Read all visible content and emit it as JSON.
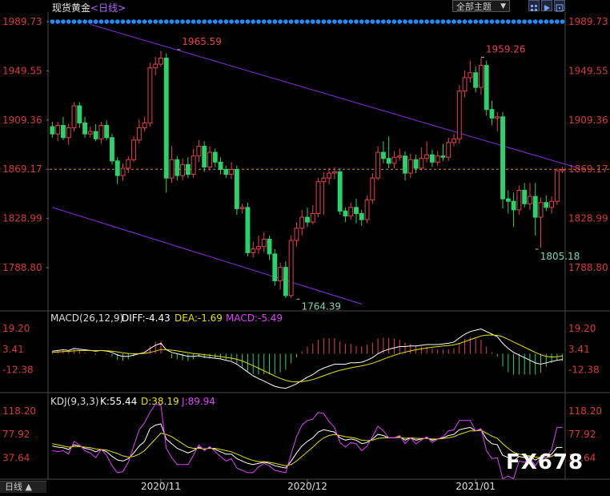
{
  "header": {
    "title": "现货黄金",
    "period": "<日线>",
    "theme_selector": "全部主题",
    "theme_arrow": "▼"
  },
  "colors": {
    "up": "#e8404a",
    "down": "#2bd26b",
    "channel": "#8a2be2",
    "dashed": "#d8901a",
    "axis_text_price": "#d73a3a",
    "diff": "#ffffff",
    "dea": "#e8e000",
    "macd_label": "#e040fb",
    "k": "#ffffff",
    "d": "#e8e000",
    "j": "#e040fb",
    "dots": "#1f8fff"
  },
  "chart_data": {
    "type": "candlestick",
    "price_axis": {
      "ticks": [
        "1989.73",
        "1949.55",
        "1909.36",
        "1869.17",
        "1828.99",
        "1788.80"
      ],
      "ylim": [
        1760.0,
        1995.0
      ]
    },
    "current_price_line": 1869.17,
    "annotations": [
      {
        "label": "1965.59",
        "value": 1965.59,
        "index": 23,
        "color": "#e8404a",
        "side": "right",
        "dir": "up"
      },
      {
        "label": "1959.26",
        "value": 1959.26,
        "index": 79,
        "color": "#e8404a",
        "side": "right",
        "dir": "up"
      },
      {
        "label": "1764.39",
        "value": 1764.39,
        "index": 45,
        "color": "#7ad7b0",
        "side": "right",
        "dir": "down"
      },
      {
        "label": "1805.18",
        "value": 1805.18,
        "index": 89,
        "color": "#7ad7b0",
        "side": "right",
        "dir": "down"
      }
    ],
    "x_labels": [
      {
        "label": "2020/11",
        "index": 20
      },
      {
        "label": "2020/12",
        "index": 47
      },
      {
        "label": "2021/01",
        "index": 78
      }
    ],
    "channel_upper": [
      {
        "index": 7,
        "value": 1987.5
      },
      {
        "index": 97,
        "value": 1870.0
      }
    ],
    "channel_lower": [
      {
        "index": 0,
        "value": 1838.0
      },
      {
        "index": 57,
        "value": 1759.0
      }
    ],
    "candles": [
      [
        1904,
        1898,
        1908,
        1895
      ],
      [
        1898,
        1905,
        1908,
        1892
      ],
      [
        1905,
        1895,
        1912,
        1893
      ],
      [
        1895,
        1903,
        1906,
        1889
      ],
      [
        1903,
        1921,
        1924,
        1900
      ],
      [
        1921,
        1907,
        1924,
        1903
      ],
      [
        1907,
        1898,
        1912,
        1895
      ],
      [
        1898,
        1900,
        1904,
        1895
      ],
      [
        1900,
        1894,
        1906,
        1892
      ],
      [
        1894,
        1905,
        1908,
        1890
      ],
      [
        1905,
        1895,
        1909,
        1893
      ],
      [
        1895,
        1876,
        1898,
        1873
      ],
      [
        1876,
        1864,
        1879,
        1857
      ],
      [
        1864,
        1870,
        1874,
        1860
      ],
      [
        1870,
        1877,
        1880,
        1866
      ],
      [
        1877,
        1893,
        1896,
        1875
      ],
      [
        1893,
        1903,
        1910,
        1890
      ],
      [
        1903,
        1907,
        1912,
        1900
      ],
      [
        1907,
        1952,
        1956,
        1904
      ],
      [
        1952,
        1955,
        1961,
        1946
      ],
      [
        1955,
        1960,
        1966,
        1953
      ],
      [
        1960,
        1862,
        1964,
        1850
      ],
      [
        1862,
        1877,
        1888,
        1858
      ],
      [
        1877,
        1864,
        1880,
        1860
      ],
      [
        1864,
        1873,
        1878,
        1860
      ],
      [
        1873,
        1865,
        1879,
        1862
      ],
      [
        1865,
        1880,
        1886,
        1862
      ],
      [
        1880,
        1888,
        1893,
        1875
      ],
      [
        1888,
        1871,
        1892,
        1867
      ],
      [
        1871,
        1883,
        1888,
        1868
      ],
      [
        1883,
        1875,
        1886,
        1871
      ],
      [
        1875,
        1869,
        1879,
        1865
      ],
      [
        1869,
        1865,
        1872,
        1862
      ],
      [
        1865,
        1869,
        1875,
        1861
      ],
      [
        1869,
        1837,
        1872,
        1832
      ],
      [
        1837,
        1838,
        1841,
        1833
      ],
      [
        1838,
        1801,
        1842,
        1798
      ],
      [
        1801,
        1804,
        1810,
        1797
      ],
      [
        1804,
        1806,
        1815,
        1800
      ],
      [
        1806,
        1812,
        1818,
        1801
      ],
      [
        1812,
        1800,
        1815,
        1795
      ],
      [
        1800,
        1778,
        1804,
        1774
      ],
      [
        1778,
        1789,
        1793,
        1771
      ],
      [
        1789,
        1766,
        1794,
        1764
      ],
      [
        1766,
        1811,
        1815,
        1764
      ],
      [
        1811,
        1821,
        1826,
        1806
      ],
      [
        1821,
        1830,
        1836,
        1815
      ],
      [
        1830,
        1826,
        1838,
        1822
      ],
      [
        1826,
        1833,
        1840,
        1824
      ],
      [
        1833,
        1859,
        1862,
        1830
      ],
      [
        1859,
        1862,
        1867,
        1832
      ],
      [
        1862,
        1866,
        1870,
        1857
      ],
      [
        1866,
        1867,
        1871,
        1861
      ],
      [
        1867,
        1835,
        1870,
        1832
      ],
      [
        1835,
        1831,
        1838,
        1826
      ],
      [
        1831,
        1838,
        1842,
        1828
      ],
      [
        1838,
        1833,
        1845,
        1825
      ],
      [
        1833,
        1828,
        1836,
        1823
      ],
      [
        1828,
        1844,
        1848,
        1825
      ],
      [
        1844,
        1862,
        1866,
        1841
      ],
      [
        1862,
        1883,
        1888,
        1860
      ],
      [
        1883,
        1878,
        1892,
        1874
      ],
      [
        1878,
        1874,
        1896,
        1870
      ],
      [
        1874,
        1879,
        1884,
        1870
      ],
      [
        1879,
        1880,
        1886,
        1876
      ],
      [
        1880,
        1866,
        1884,
        1860
      ],
      [
        1866,
        1877,
        1882,
        1862
      ],
      [
        1877,
        1870,
        1881,
        1866
      ],
      [
        1870,
        1878,
        1887,
        1868
      ],
      [
        1878,
        1881,
        1892,
        1875
      ],
      [
        1881,
        1875,
        1885,
        1871
      ],
      [
        1875,
        1880,
        1884,
        1872
      ],
      [
        1880,
        1879,
        1890,
        1876
      ],
      [
        1879,
        1891,
        1895,
        1876
      ],
      [
        1891,
        1894,
        1898,
        1888
      ],
      [
        1894,
        1933,
        1938,
        1890
      ],
      [
        1933,
        1944,
        1950,
        1928
      ],
      [
        1944,
        1948,
        1958,
        1940
      ],
      [
        1948,
        1936,
        1953,
        1932
      ],
      [
        1936,
        1954,
        1960,
        1930
      ],
      [
        1954,
        1918,
        1958,
        1913
      ],
      [
        1918,
        1911,
        1925,
        1905
      ],
      [
        1911,
        1912,
        1916,
        1900
      ],
      [
        1912,
        1845,
        1916,
        1837
      ],
      [
        1845,
        1843,
        1852,
        1833
      ],
      [
        1843,
        1836,
        1850,
        1822
      ],
      [
        1836,
        1852,
        1856,
        1832
      ],
      [
        1852,
        1841,
        1858,
        1838
      ],
      [
        1841,
        1847,
        1858,
        1836
      ],
      [
        1847,
        1830,
        1858,
        1815
      ],
      [
        1830,
        1842,
        1846,
        1805
      ],
      [
        1842,
        1838,
        1848,
        1835
      ],
      [
        1838,
        1843,
        1847,
        1833
      ],
      [
        1843,
        1868,
        1870,
        1840
      ],
      [
        1868,
        1869,
        1871,
        1866
      ]
    ],
    "macd": {
      "label": "MACD(26,12,9)",
      "diff_label": "DIFF:-4.43",
      "dea_label": "DEA:-1.69",
      "macd_label": "MACD:-5.49",
      "ticks": [
        "19.20",
        "3.41",
        "-12.38"
      ],
      "ylim": [
        -28.0,
        23.0
      ],
      "diff": [
        2,
        2.5,
        3,
        2.5,
        4,
        3.5,
        3,
        2.5,
        2,
        2.5,
        2,
        1,
        -1,
        -2,
        -2,
        -1,
        0,
        1,
        4,
        6.5,
        8,
        3,
        1,
        0,
        -1,
        -2,
        -2,
        -1.5,
        -2.5,
        -3,
        -3.5,
        -4,
        -5,
        -6,
        -8,
        -11,
        -14,
        -17,
        -19,
        -21,
        -23,
        -25,
        -26,
        -26.5,
        -25,
        -23,
        -20.5,
        -18,
        -16,
        -13,
        -11,
        -9.5,
        -8,
        -8,
        -8,
        -7,
        -7,
        -6.5,
        -5,
        -3,
        0,
        2,
        3.5,
        4.5,
        5.5,
        5.5,
        6,
        6,
        6.5,
        7,
        7,
        7,
        7.5,
        8,
        9,
        12,
        15,
        17,
        18,
        19,
        17,
        15,
        13,
        8,
        4,
        1,
        -1,
        -3,
        -5,
        -7,
        -8,
        -7,
        -6,
        -5,
        -4.43
      ],
      "dea": [
        1,
        1.3,
        1.6,
        1.8,
        2.2,
        2.4,
        2.5,
        2.5,
        2.4,
        2.4,
        2.3,
        2,
        1.4,
        0.7,
        0.2,
        0,
        0,
        0.2,
        1,
        2,
        3.2,
        3.1,
        2.7,
        2.2,
        1.5,
        0.8,
        0.2,
        -0.2,
        -0.7,
        -1.2,
        -1.7,
        -2.2,
        -2.8,
        -3.4,
        -4.3,
        -5.6,
        -7.3,
        -9.2,
        -11.1,
        -13.1,
        -15.1,
        -17.1,
        -18.9,
        -20.4,
        -21.3,
        -21.6,
        -21.4,
        -20.7,
        -19.8,
        -18.4,
        -16.9,
        -15.4,
        -13.9,
        -12.7,
        -11.8,
        -10.8,
        -10,
        -9.3,
        -8.4,
        -7.3,
        -5.8,
        -4.2,
        -2.6,
        -1.2,
        0.1,
        1.2,
        2.2,
        3,
        3.7,
        4.4,
        5,
        5.4,
        5.9,
        6.3,
        6.8,
        7.9,
        9.3,
        10.8,
        12.2,
        13.6,
        14.3,
        14.4,
        14.1,
        12.9,
        11.1,
        9,
        7,
        5,
        3,
        1,
        -0.8,
        -2,
        -2.5,
        -2.4,
        -1.69
      ]
    },
    "kdj": {
      "label": "KDJ(9,3,3)",
      "k_label": "K:55.44",
      "d_label": "D:38.19",
      "j_label": "J:89.94",
      "ticks": [
        "118.20",
        "77.92",
        "37.64"
      ],
      "ylim": [
        5.0,
        125.0
      ],
      "k": [
        58,
        56,
        55,
        52,
        60,
        58,
        54,
        52,
        48,
        52,
        48,
        40,
        34,
        32,
        36,
        46,
        58,
        66,
        88,
        94,
        96,
        70,
        62,
        54,
        50,
        46,
        50,
        56,
        52,
        55,
        52,
        48,
        44,
        44,
        36,
        32,
        28,
        26,
        28,
        30,
        28,
        24,
        22,
        20,
        32,
        46,
        58,
        66,
        72,
        82,
        86,
        84,
        82,
        72,
        68,
        70,
        68,
        62,
        64,
        70,
        78,
        76,
        72,
        72,
        74,
        68,
        72,
        68,
        70,
        72,
        68,
        70,
        72,
        76,
        78,
        86,
        88,
        90,
        84,
        86,
        70,
        62,
        60,
        42,
        38,
        32,
        40,
        38,
        40,
        34,
        38,
        38,
        44,
        55.44,
        55.44
      ],
      "d": [
        62,
        60,
        58,
        56,
        57,
        57,
        56,
        55,
        53,
        52,
        51,
        48,
        45,
        41,
        39,
        40,
        44,
        50,
        60,
        70,
        80,
        78,
        74,
        68,
        62,
        56,
        54,
        54,
        53,
        54,
        54,
        52,
        50,
        48,
        44,
        40,
        36,
        33,
        31,
        31,
        30,
        28,
        26,
        24,
        26,
        32,
        40,
        48,
        56,
        65,
        72,
        76,
        78,
        76,
        74,
        73,
        71,
        68,
        67,
        68,
        71,
        72,
        72,
        72,
        73,
        71,
        72,
        71,
        71,
        71,
        70,
        70,
        71,
        72,
        74,
        78,
        81,
        84,
        84,
        85,
        80,
        75,
        71,
        62,
        54,
        47,
        44,
        42,
        41,
        39,
        38,
        38,
        40,
        45,
        38.19
      ],
      "j": [
        50,
        48,
        50,
        44,
        66,
        60,
        50,
        46,
        38,
        52,
        42,
        24,
        12,
        14,
        30,
        58,
        86,
        98,
        116,
        130,
        128,
        54,
        38,
        26,
        26,
        26,
        42,
        60,
        50,
        57,
        48,
        40,
        32,
        36,
        20,
        16,
        12,
        12,
        22,
        28,
        24,
        16,
        14,
        12,
        44,
        74,
        94,
        102,
        104,
        116,
        114,
        100,
        90,
        64,
        56,
        64,
        62,
        50,
        58,
        74,
        92,
        84,
        72,
        72,
        76,
        62,
        72,
        62,
        68,
        74,
        64,
        70,
        74,
        84,
        86,
        102,
        102,
        102,
        84,
        88,
        50,
        36,
        38,
        2,
        6,
        2,
        32,
        30,
        38,
        24,
        38,
        38,
        52,
        89.94,
        89.94
      ]
    }
  }
}
